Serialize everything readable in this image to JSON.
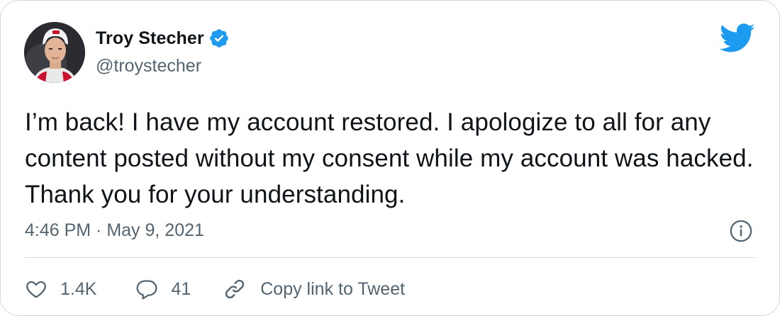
{
  "tweet": {
    "author": {
      "display_name": "Troy Stecher",
      "handle": "@troystecher",
      "verified": true,
      "avatar_icon": "avatar",
      "verified_icon": "verified-badge-icon"
    },
    "text": "I’m back! I have my account restored. I apologize to all for any content posted without my consent while my account was hacked. Thank you for your understanding.",
    "timestamp": "4:46 PM · May 9, 2021",
    "actions": {
      "likes": {
        "icon": "heart-icon",
        "count": "1.4K"
      },
      "replies": {
        "icon": "reply-bubble-icon",
        "count": "41"
      },
      "copy_link": {
        "icon": "link-icon",
        "label": "Copy link to Tweet"
      }
    },
    "brand_icon": "twitter-bird-icon",
    "info_icon": "info-icon"
  },
  "colors": {
    "text_primary": "#0f1419",
    "text_secondary": "#536471",
    "brand_blue": "#1d9bf0",
    "border": "#cfd9de"
  }
}
